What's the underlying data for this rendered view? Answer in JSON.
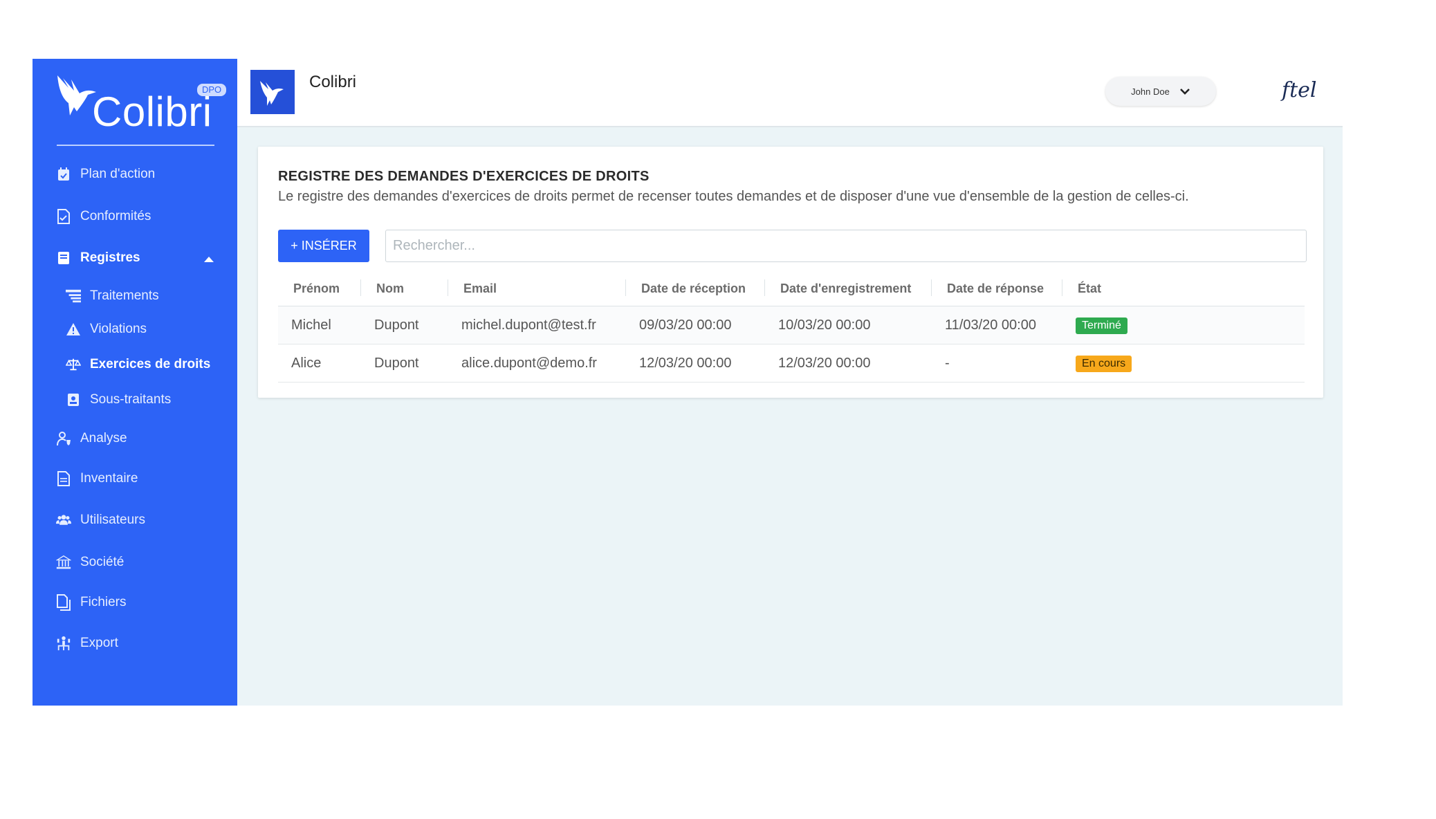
{
  "app": {
    "name": "Colibri",
    "badge": "DPO",
    "brand_logo_text": "ftel"
  },
  "sidebar": {
    "items": [
      {
        "label": "Plan d'action",
        "icon": "calendar-check-icon"
      },
      {
        "label": "Conformités",
        "icon": "file-check-icon"
      },
      {
        "label": "Registres",
        "icon": "book-icon"
      },
      {
        "label": "Traitements",
        "icon": "list-icon"
      },
      {
        "label": "Violations",
        "icon": "warning-icon"
      },
      {
        "label": "Exercices de droits",
        "icon": "balance-scale-icon"
      },
      {
        "label": "Sous-traitants",
        "icon": "id-badge-icon"
      },
      {
        "label": "Analyse",
        "icon": "user-shield-icon"
      },
      {
        "label": "Inventaire",
        "icon": "file-icon"
      },
      {
        "label": "Utilisateurs",
        "icon": "users-icon"
      },
      {
        "label": "Société",
        "icon": "building-icon"
      },
      {
        "label": "Fichiers",
        "icon": "files-icon"
      },
      {
        "label": "Export",
        "icon": "export-icon"
      }
    ]
  },
  "header": {
    "title": "Colibri",
    "user": "John Doe"
  },
  "card": {
    "title": "REGISTRE DES DEMANDES D'EXERCICES DE DROITS",
    "description": "Le registre des demandes d'exercices de droits permet de recenser toutes demandes et de disposer d'une vue d'ensemble de la gestion de celles-ci.",
    "insert_label": "+ INSÉRER",
    "search_placeholder": "Rechercher..."
  },
  "table": {
    "columns": [
      "Prénom",
      "Nom",
      "Email",
      "Date de réception",
      "Date d'enregistrement",
      "Date de réponse",
      "État"
    ],
    "rows": [
      {
        "prenom": "Michel",
        "nom": "Dupont",
        "email": "michel.dupont@test.fr",
        "reception": "09/03/20 00:00",
        "enregistrement": "10/03/20 00:00",
        "reponse": "11/03/20 00:00",
        "etat": "Terminé"
      },
      {
        "prenom": "Alice",
        "nom": "Dupont",
        "email": "alice.dupont@demo.fr",
        "reception": "12/03/20 00:00",
        "enregistrement": "12/03/20 00:00",
        "reponse": "-",
        "etat": "En cours"
      }
    ]
  },
  "colors": {
    "primary": "#2d63f6",
    "status_done": "#2eaa4f",
    "status_in_progress": "#f7a81b"
  }
}
